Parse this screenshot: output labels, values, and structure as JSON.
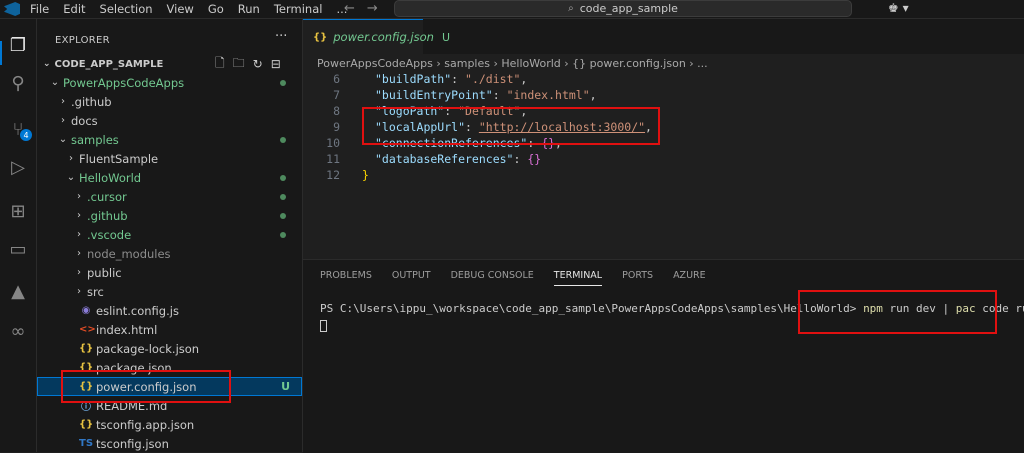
{
  "menu": {
    "items": [
      "File",
      "Edit",
      "Selection",
      "View",
      "Go",
      "Run",
      "Terminal",
      "..."
    ],
    "search_text": "code_app_sample"
  },
  "explorer": {
    "title": "EXPLORER",
    "more": "···",
    "section": "CODE_APP_SAMPLE",
    "source_control_badge": "4",
    "tree": [
      {
        "label": "PowerAppsCodeApps",
        "chev": "⌄",
        "icon": "",
        "status": "dot",
        "green": true
      },
      {
        "label": ".github",
        "chev": "›",
        "icon": ""
      },
      {
        "label": "docs",
        "chev": "›",
        "icon": ""
      },
      {
        "label": "samples",
        "chev": "⌄",
        "icon": "",
        "status": "dot",
        "green": true
      },
      {
        "label": "FluentSample",
        "chev": "›",
        "icon": ""
      },
      {
        "label": "HelloWorld",
        "chev": "⌄",
        "icon": "",
        "status": "dot",
        "green": true
      },
      {
        "label": ".cursor",
        "chev": "›",
        "icon": "",
        "status": "dot",
        "green": true
      },
      {
        "label": ".github",
        "chev": "›",
        "icon": "",
        "status": "dot",
        "green": true
      },
      {
        "label": ".vscode",
        "chev": "›",
        "icon": "",
        "status": "dot",
        "green": true
      },
      {
        "label": "node_modules",
        "chev": "›",
        "icon": "",
        "dim": true
      },
      {
        "label": "public",
        "chev": "›",
        "icon": ""
      },
      {
        "label": "src",
        "chev": "›",
        "icon": ""
      },
      {
        "label": "eslint.config.js",
        "chev": "",
        "icon": "◉"
      },
      {
        "label": "index.html",
        "chev": "",
        "icon": "<>"
      },
      {
        "label": "package-lock.json",
        "chev": "",
        "icon": "{}"
      },
      {
        "label": "package.json",
        "chev": "",
        "icon": "{}"
      },
      {
        "label": "power.config.json",
        "chev": "",
        "icon": "{}",
        "status": "U",
        "selected": true
      },
      {
        "label": "README.md",
        "chev": "",
        "icon": "ⓘ"
      },
      {
        "label": "tsconfig.app.json",
        "chev": "",
        "icon": "{}"
      },
      {
        "label": "tsconfig.json",
        "chev": "",
        "icon": "TS"
      }
    ]
  },
  "editor": {
    "tab": {
      "icon": "{}",
      "name": "power.config.json",
      "status": "U"
    },
    "breadcrumb": "PowerAppsCodeApps › samples › HelloWorld › {} power.config.json › ...",
    "lines": [
      {
        "n": "6",
        "key": "\"buildPath\"",
        "value": "\"./dist\"",
        "tail": ","
      },
      {
        "n": "7",
        "key": "\"buildEntryPoint\"",
        "value": "\"index.html\"",
        "tail": ","
      },
      {
        "n": "8",
        "key": "\"logoPath\"",
        "value": "\"Default\"",
        "tail": ","
      },
      {
        "n": "9",
        "key": "\"localAppUrl\"",
        "value": "\"http://localhost:3000/\"",
        "tail": ","
      },
      {
        "n": "10",
        "key": "\"connectionReferences\"",
        "value": "{}",
        "tail": ","
      },
      {
        "n": "11",
        "key": "\"databaseReferences\"",
        "value": "{}",
        "tail": ""
      },
      {
        "n": "12",
        "key": "",
        "value": "}",
        "tail": ""
      }
    ]
  },
  "panel": {
    "tabs": [
      "PROBLEMS",
      "OUTPUT",
      "DEBUG CONSOLE",
      "TERMINAL",
      "PORTS",
      "AZURE"
    ],
    "active_tab": "TERMINAL",
    "prompt": "PS C:\\Users\\ippu_\\workspace\\code_app_sample\\PowerAppsCodeApps\\samples\\HelloWorld>",
    "cmd1": "npm",
    "args1": " run dev | ",
    "cmd2": "pac",
    "args2": " code run"
  }
}
